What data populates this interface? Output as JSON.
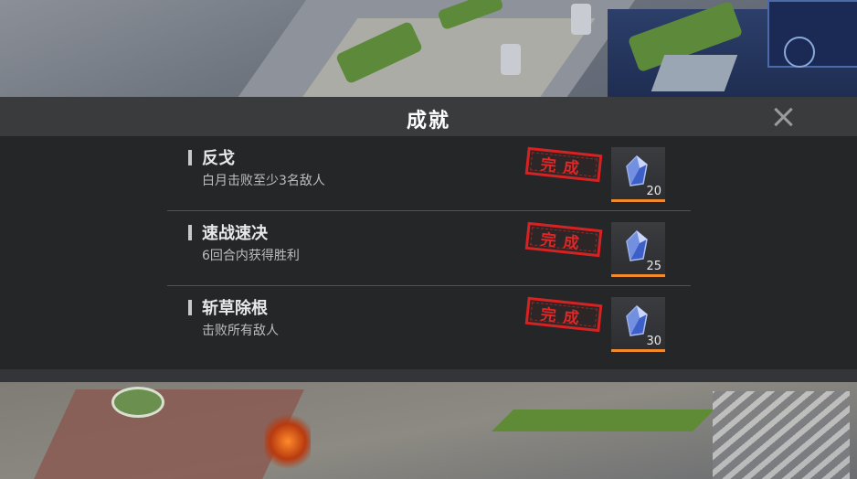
{
  "title": "成就",
  "close_icon": "close-icon",
  "achievements": [
    {
      "name": "反戈",
      "description": "白月击败至少3名敌人",
      "status": "完成",
      "reward_count": "20",
      "reward_icon": "blue-crystal-icon"
    },
    {
      "name": "速战速决",
      "description": "6回合内获得胜利",
      "status": "完成",
      "reward_count": "25",
      "reward_icon": "blue-crystal-icon"
    },
    {
      "name": "斩草除根",
      "description": "击败所有敌人",
      "status": "完成",
      "reward_count": "30",
      "reward_icon": "blue-crystal-icon"
    }
  ],
  "colors": {
    "panel_bg": "#222325",
    "header_bg": "#3a3b3d",
    "stamp_red": "#d62222",
    "reward_accent": "#f08a2a"
  }
}
